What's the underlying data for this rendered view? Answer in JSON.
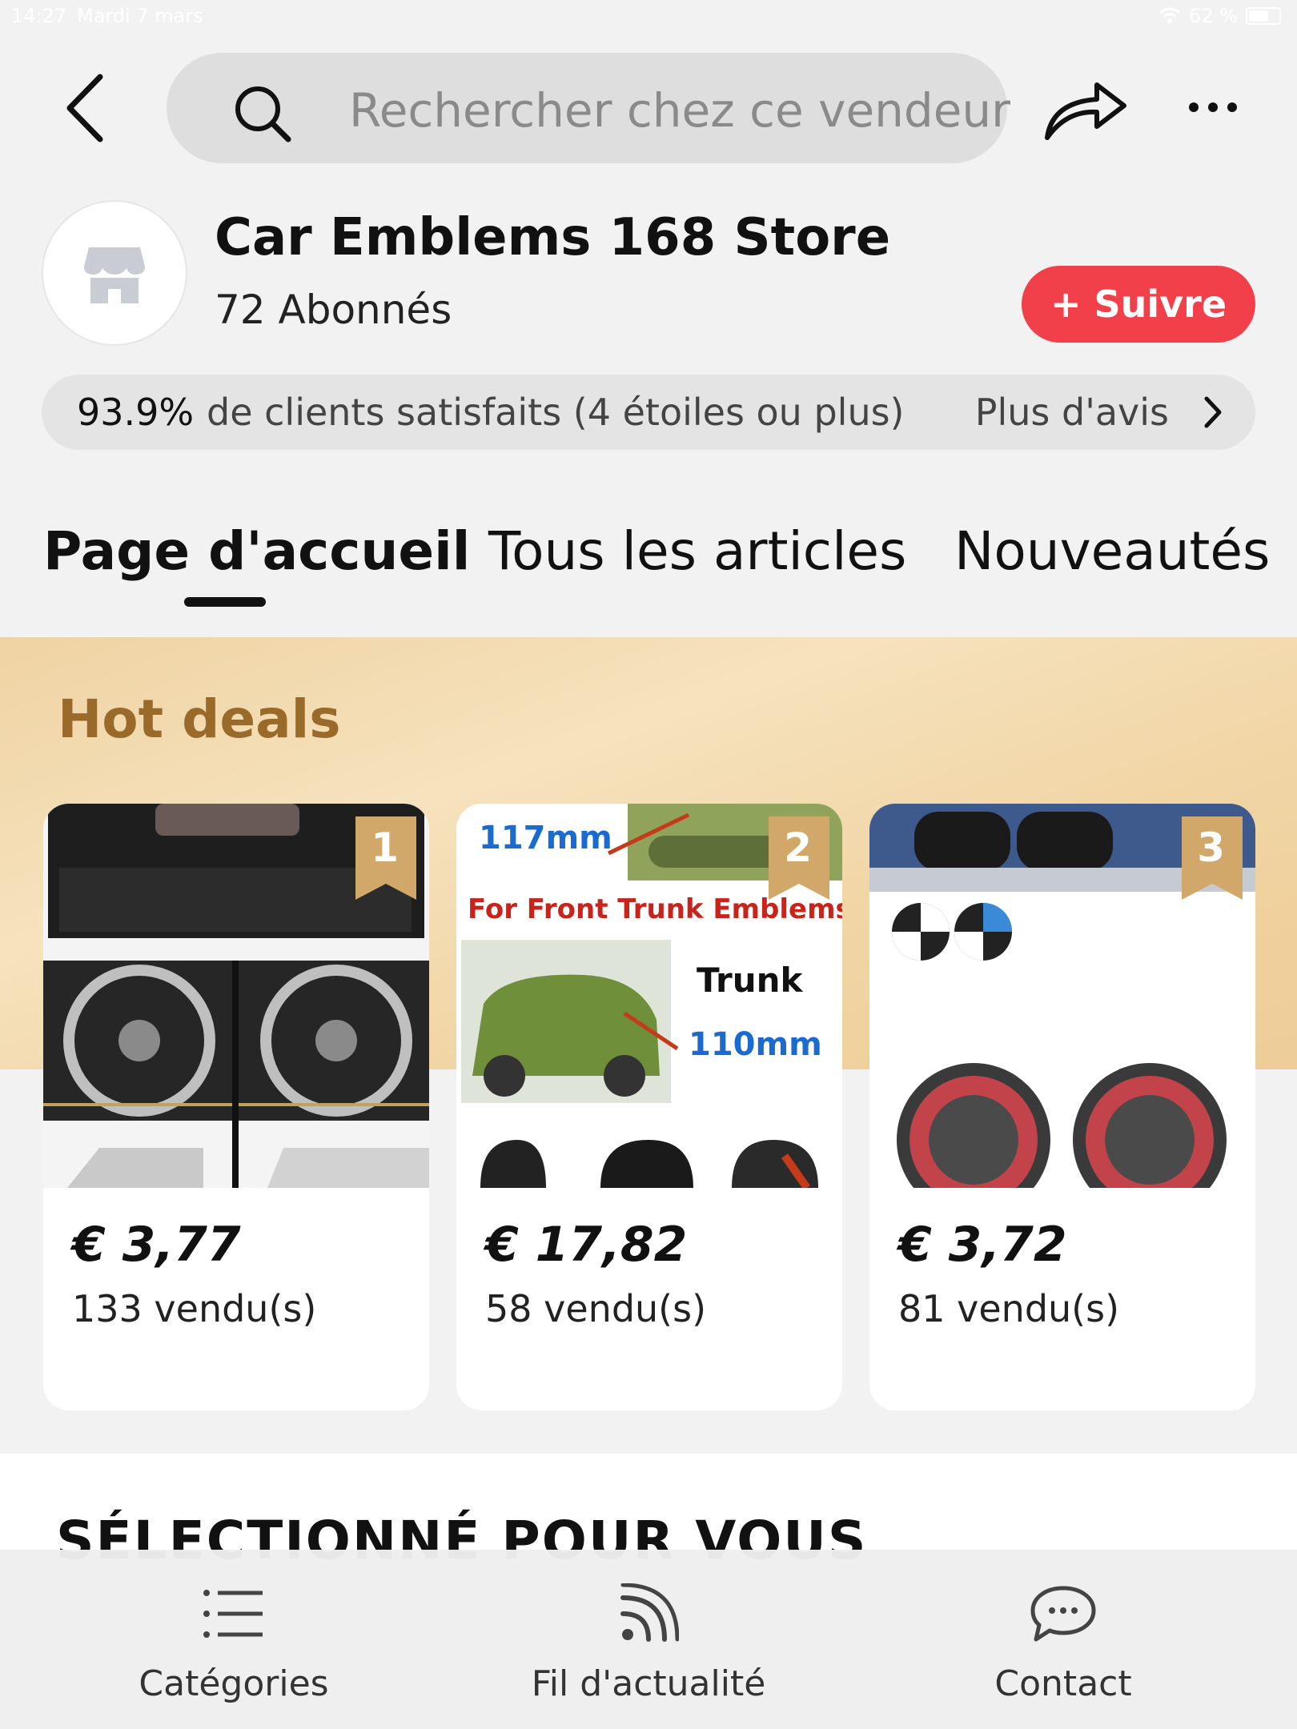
{
  "status_bar": {
    "time": "14:27",
    "date": "Mardi 7 mars",
    "battery": "62 %"
  },
  "header": {
    "search_placeholder": "Rechercher chez ce vendeur"
  },
  "store": {
    "name": "Car Emblems 168 Store",
    "followers": "72 Abonnés",
    "follow_label": "+ Suivre",
    "satisfaction_pct": "93.9%",
    "satisfaction_text": "de clients satisfaits (4 étoiles ou plus)",
    "more_reviews": "Plus d'avis"
  },
  "tabs": [
    {
      "label": "Page d'accueil",
      "active": true
    },
    {
      "label": "Tous les articles",
      "active": false
    },
    {
      "label": "Nouveautés",
      "active": false
    }
  ],
  "hot_deals": {
    "title": "Hot deals",
    "items": [
      {
        "rank": "1",
        "price": "€ 3,77",
        "sold": "133 vendu(s)"
      },
      {
        "rank": "2",
        "price": "€ 17,82",
        "sold": "58 vendu(s)",
        "image_text": {
          "top": "117mm",
          "banner": "For Front Trunk Emblems",
          "trunk": "Trunk",
          "trunk_size": "110mm"
        }
      },
      {
        "rank": "3",
        "price": "€ 3,72",
        "sold": "81 vendu(s)"
      }
    ]
  },
  "selected": {
    "title": "SÉLECTIONNÉ POUR VOUS"
  },
  "bottom_nav": [
    {
      "label": "Catégories",
      "icon": "list-icon"
    },
    {
      "label": "Fil d'actualité",
      "icon": "feed-icon"
    },
    {
      "label": "Contact",
      "icon": "chat-icon"
    }
  ],
  "colors": {
    "accent": "#f2404a",
    "hot_title": "#9a6a2a",
    "badge": "#d2a86a"
  }
}
